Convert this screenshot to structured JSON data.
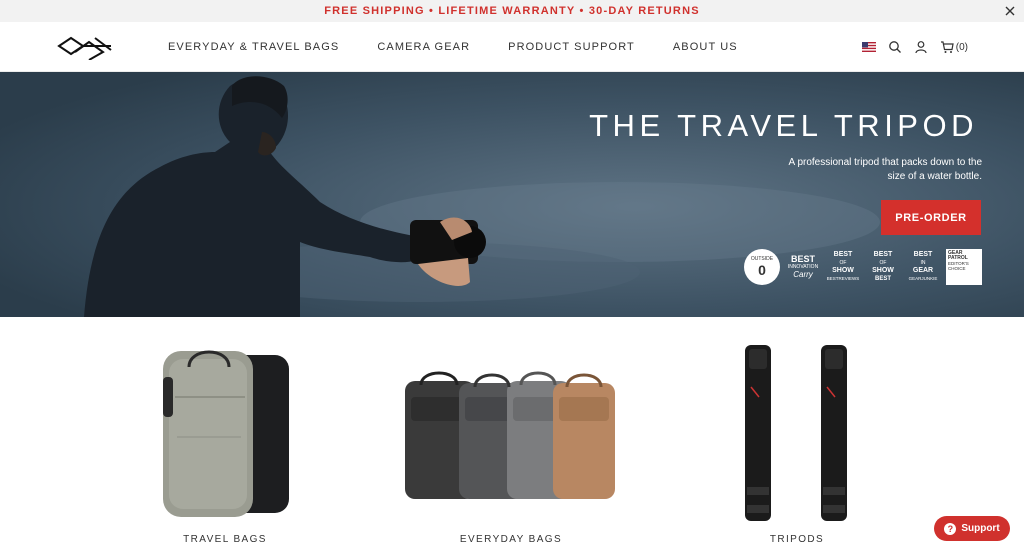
{
  "promo": {
    "text": "FREE SHIPPING • LIFETIME WARRANTY • 30-DAY RETURNS",
    "close_icon": "close-icon",
    "color": "#d0312d"
  },
  "header": {
    "logo_icon": "peak-design-logo",
    "nav": [
      {
        "label": "EVERYDAY & TRAVEL BAGS"
      },
      {
        "label": "CAMERA GEAR"
      },
      {
        "label": "PRODUCT SUPPORT"
      },
      {
        "label": "ABOUT US"
      }
    ],
    "utilities": {
      "flag_icon": "us-flag-icon",
      "search_icon": "search-icon",
      "account_icon": "user-icon",
      "cart_icon": "cart-icon",
      "cart_count": "(0)"
    }
  },
  "hero": {
    "title": "THE TRAVEL TRIPOD",
    "subtitle": "A professional tripod that packs down to the size of a water bottle.",
    "cta": "PRE-ORDER",
    "cta_color": "#d4302c",
    "awards": [
      {
        "line1": "OUTSIDE",
        "line2": "0"
      },
      {
        "line1": "BEST",
        "line2": "INNOVATION",
        "line3": "Carry"
      },
      {
        "line1": "BEST",
        "line2": "OF",
        "line3": "SHOW",
        "line4": "BESTREVIEWS"
      },
      {
        "line1": "BEST",
        "line2": "OF",
        "line3": "SHOW",
        "line4": "BEST"
      },
      {
        "line1": "BEST",
        "line2": "IN",
        "line3": "GEAR",
        "line4": "GEARJUNKIE"
      },
      {
        "line1": "GEAR PATROL",
        "line2": "EDITOR'S CHOICE"
      }
    ]
  },
  "products": [
    {
      "label": "TRAVEL BAGS"
    },
    {
      "label": "EVERYDAY BAGS"
    },
    {
      "label": "TRIPODS"
    }
  ],
  "support": {
    "label": "Support",
    "icon": "question-icon",
    "color": "#d0312d"
  }
}
